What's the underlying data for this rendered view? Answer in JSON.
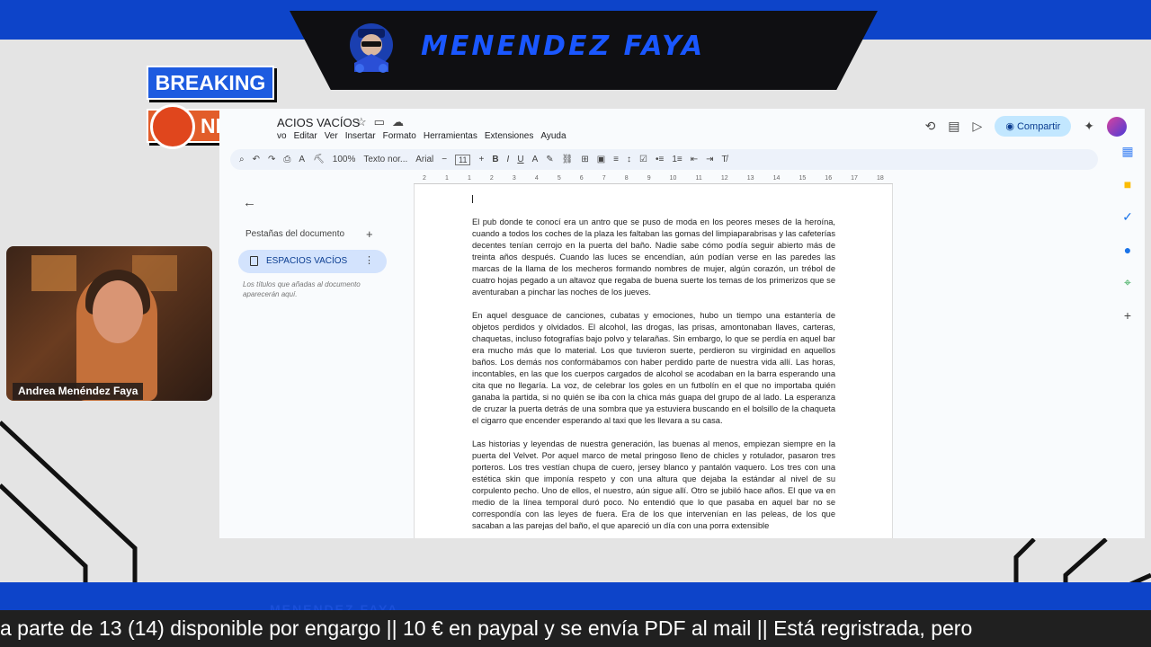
{
  "overlay": {
    "banner_title": "MENENDEZ FAYA",
    "breaking_label": "BREAKING",
    "news_label": "NEWS",
    "webcam_name": "Andrea Menéndez Faya",
    "ticker_text": "a parte de 13 (14) disponible por engargo || 10 € en paypal y se envía PDF al mail || Está regristrada, pero",
    "bottom_ghost": "MENENDEZ FAYA",
    "colors": {
      "blue": "#0d44c9",
      "orange": "#e25d2a",
      "dark": "#202020"
    }
  },
  "docs": {
    "title": "ACIOS VACÍOS",
    "menu": [
      "vo",
      "Editar",
      "Ver",
      "Insertar",
      "Formato",
      "Herramientas",
      "Extensiones",
      "Ayuda"
    ],
    "share_label": "Compartir",
    "toolbar": {
      "zoom": "100%",
      "style": "Texto nor...",
      "font": "Arial",
      "font_size": "11"
    },
    "ruler_ticks": [
      "2",
      "1",
      "1",
      "2",
      "3",
      "4",
      "5",
      "6",
      "7",
      "8",
      "9",
      "10",
      "11",
      "12",
      "13",
      "14",
      "15",
      "16",
      "17",
      "18"
    ],
    "side_panel": {
      "heading": "Pestañas del documento",
      "tab_label": "ESPACIOS VACÍOS",
      "hint": "Los títulos que añadas al documento aparecerán aquí."
    },
    "paragraphs": [
      "El pub donde te conocí era un antro que se puso de moda en los peores meses de la heroína, cuando a todos los coches de la plaza les faltaban las gomas del limpiaparabrisas y las cafeterías decentes tenían cerrojo en la puerta del baño. Nadie sabe cómo podía seguir abierto más de treinta años después. Cuando las luces se encendían, aún podían verse en las paredes las marcas de la llama de los mecheros formando nombres de mujer, algún corazón, un trébol de cuatro hojas pegado a un altavoz que regaba de buena suerte los temas de los primerizos que se aventuraban a pinchar las noches de los jueves.",
      "En aquel desguace de canciones, cubatas y emociones, hubo un tiempo una estantería de objetos perdidos y olvidados. El alcohol, las drogas, las prisas, amontonaban llaves, carteras, chaquetas, incluso fotografías bajo polvo y telarañas. Sin embargo, lo que se perdía en aquel bar era mucho más que lo material. Los que tuvieron suerte, perdieron su virginidad en aquellos baños. Los demás nos conformábamos con haber perdido parte de nuestra vida allí. Las horas, incontables, en las que los cuerpos cargados de alcohol se acodaban en la barra esperando una cita que no llegaría. La voz, de celebrar los goles en un futbolín en el que no importaba quién ganaba la partida, si no quién se iba con la chica más guapa del grupo de al lado. La esperanza de cruzar la puerta detrás de una sombra que ya estuviera buscando en el bolsillo de la chaqueta el cigarro que encender esperando al taxi que les llevara a su casa.",
      "Las historias y leyendas de nuestra generación, las buenas al menos, empiezan siempre en la puerta del Velvet. Por aquel marco de metal pringoso lleno de chicles y rotulador, pasaron tres porteros. Los tres vestían chupa de cuero, jersey blanco y pantalón vaquero. Los tres con una estética skin que imponía respeto y con una altura que dejaba la estándar al nivel de su corpulento pecho. Uno de ellos, el nuestro, aún sigue allí. Otro se jubiló hace años. El que va en medio de la línea temporal duró poco. No entendió que lo que pasaba en aquel bar no se correspondía con las leyes de fuera. Era de los que intervenían en las peleas, de los que sacaban a las parejas del baño, el que apareció un día con una porra extensible"
    ]
  }
}
